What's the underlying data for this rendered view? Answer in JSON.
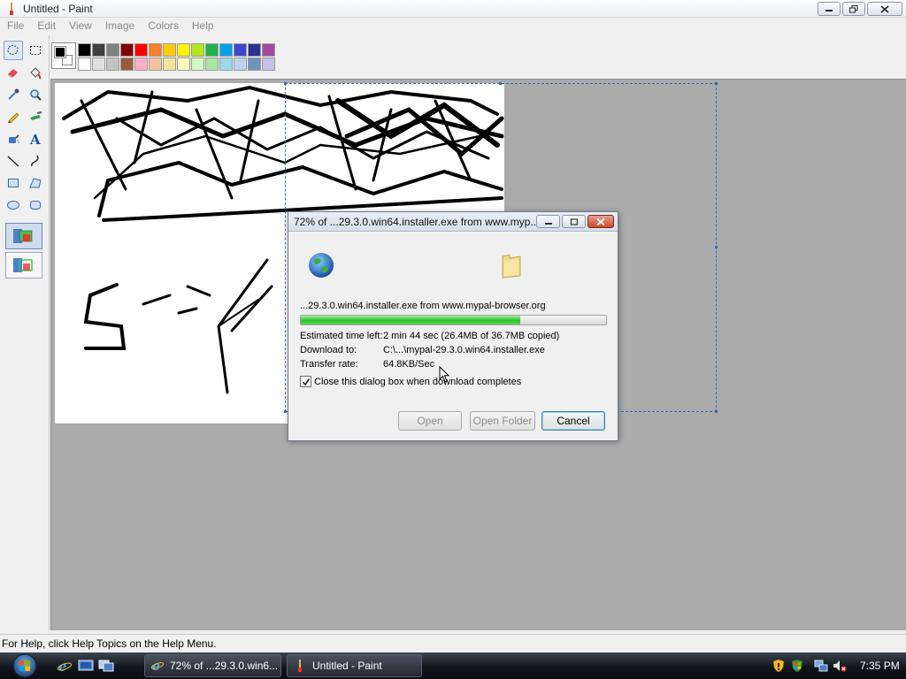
{
  "paint": {
    "title": "Untitled - Paint",
    "menu": [
      "File",
      "Edit",
      "View",
      "Image",
      "Colors",
      "Help"
    ],
    "tools": [
      "free-form-select",
      "select",
      "eraser",
      "fill-with-color",
      "pick-color",
      "magnifier",
      "pencil",
      "brush",
      "airbrush",
      "text",
      "line",
      "curve",
      "rectangle",
      "polygon",
      "ellipse",
      "rounded-rectangle"
    ],
    "palette_top": [
      "#000000",
      "#404040",
      "#808080",
      "#800000",
      "#ff0000",
      "#ff7f27",
      "#ffc90e",
      "#fff200",
      "#b5e61d",
      "#22b14c",
      "#00a2e8",
      "#3f48cc",
      "#2e3192",
      "#a349a4"
    ],
    "palette_bottom": [
      "#ffffff",
      "#e0e0e0",
      "#c3c3c3",
      "#9c5a3c",
      "#ffaec9",
      "#efc39b",
      "#f5e49c",
      "#ffffbe",
      "#d3f9bc",
      "#a8e6a1",
      "#99d9ea",
      "#b8d4f0",
      "#7092be",
      "#c8bfe7"
    ],
    "status": "For Help, click Help Topics on the Help Menu."
  },
  "dialog": {
    "title": "72% of ...29.3.0.win64.installer.exe from www.myp...",
    "filename_line": "...29.3.0.win64.installer.exe from www.mypal-browser.org",
    "progress_percent": 72,
    "rows": [
      {
        "label": "Estimated time left:",
        "value": "2 min 44 sec (26.4MB of 36.7MB copied)"
      },
      {
        "label": "Download to:",
        "value": "C:\\...\\mypal-29.3.0.win64.installer.exe"
      },
      {
        "label": "Transfer rate:",
        "value": "64.8KB/Sec"
      }
    ],
    "close_checkbox_label": "Close this dialog box when download completes",
    "close_checkbox_checked": true,
    "buttons": {
      "open": "Open",
      "open_folder": "Open Folder",
      "cancel": "Cancel"
    }
  },
  "taskbar": {
    "tasks": [
      "72% of ...29.3.0.win6...",
      "Untitled - Paint"
    ],
    "clock": "7:35 PM"
  }
}
